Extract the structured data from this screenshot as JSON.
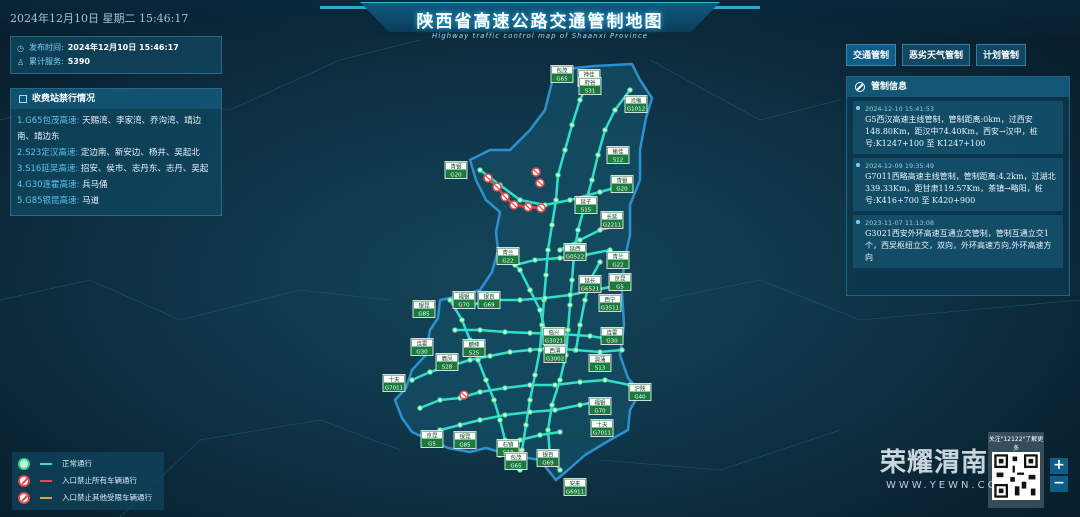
{
  "header": {
    "datetime": "2024年12月10日 星期二  15:46:17",
    "title": "陕西省高速公路交通管制地图",
    "subtitle": "Highway traffic control map of Shaanxi Province"
  },
  "publish": {
    "time_label": "发布时间:",
    "time_value": "2024年12月10日  15:46:17",
    "service_label": "累计服务:",
    "service_value": "5390"
  },
  "toll_panel": {
    "title": "收费站禁行情况",
    "items": [
      {
        "road": "1.G65包茂高速:",
        "stations": "天赐湾、李家湾、乔沟湾、靖边南、靖边东"
      },
      {
        "road": "2.S23定汉高速:",
        "stations": "定边南、新安边、杨井、吴起北"
      },
      {
        "road": "3.S16延吴高速:",
        "stations": "招安、侯市、志丹东、志丹、吴起"
      },
      {
        "road": "4.G30连霍高速:",
        "stations": "兵马俑"
      },
      {
        "road": "5.G85银昆高速:",
        "stations": "马道"
      }
    ]
  },
  "tabs": [
    "交通管制",
    "恶劣天气管制",
    "计划管制"
  ],
  "control_panel": {
    "title": "管制信息",
    "notices": [
      {
        "time": "2024-12-10 15:41:53",
        "text": "G5西汉高速主线管制，管制距离:0km，过西安148.80Km，距汉中74.40Km，西安→汉中，桩号:K1247+100 至 K1247+100"
      },
      {
        "time": "2024-12-09 19:35:49",
        "text": "G7011西略高速主线管制，管制距离:4.2km，过湖北339.33Km，距甘肃119.57Km，茶镇→略阳，桩号:K416+700 至 K420+900"
      },
      {
        "time": "2023-11-07 11:13:08",
        "text": "G3021西安外环高速互通立交管制，管制互通立交1个，西吴枢纽立交，双向，外环高速方向,外环高速方向"
      }
    ]
  },
  "legend": {
    "items": [
      {
        "label": "正常通行",
        "line_color": "#2fe0c8"
      },
      {
        "label": "入口禁止所有车辆通行",
        "line_color": "#e04a4a"
      },
      {
        "label": "入口禁止其他受限车辆通行",
        "line_color": "#f0a030"
      }
    ]
  },
  "highway_labels": [
    {
      "name": "包茂",
      "code": "G65"
    },
    {
      "name": "神佳",
      "code": "S11"
    },
    {
      "name": "府谷",
      "code": "S31"
    },
    {
      "name": "沧榆",
      "code": "G1012"
    },
    {
      "name": "榆佳",
      "code": "S12"
    },
    {
      "name": "青银",
      "code": "G20"
    },
    {
      "name": "青银",
      "code": "G20"
    },
    {
      "name": "延子",
      "code": "S15"
    },
    {
      "name": "长延",
      "code": "G2211"
    },
    {
      "name": "青兰",
      "code": "G22"
    },
    {
      "name": "延西",
      "code": "G0522"
    },
    {
      "name": "青兰",
      "code": "G22"
    },
    {
      "name": "延长",
      "code": "G6521"
    },
    {
      "name": "京昆",
      "code": "G5"
    },
    {
      "name": "福银",
      "code": "G70"
    },
    {
      "name": "银昆",
      "code": "G85"
    },
    {
      "name": "银百",
      "code": "G69"
    },
    {
      "name": "西宁",
      "code": "G3511"
    },
    {
      "name": "临兴",
      "code": "G3021"
    },
    {
      "name": "连霍",
      "code": "G30"
    },
    {
      "name": "麟绛",
      "code": "S25"
    },
    {
      "name": "连霍",
      "code": "G30"
    },
    {
      "name": "西渭",
      "code": "G3002"
    },
    {
      "name": "眉凤",
      "code": "S28"
    },
    {
      "name": "渭蒲",
      "code": "S13"
    },
    {
      "name": "十天",
      "code": "G7011"
    },
    {
      "name": "沪陕",
      "code": "G40"
    },
    {
      "name": "福银",
      "code": "G70"
    },
    {
      "name": "十天",
      "code": "G7011"
    },
    {
      "name": "京昆",
      "code": "G5"
    },
    {
      "name": "银昆",
      "code": "G85"
    },
    {
      "name": "石镇",
      "code": "S27"
    },
    {
      "name": "包茂",
      "code": "G65"
    },
    {
      "name": "银百",
      "code": "G69"
    },
    {
      "name": "安来",
      "code": "G6911"
    }
  ],
  "watermark": {
    "text": "荣耀渭南",
    "url": "WWW.YEWN.COM",
    "qr_caption": "关注\"12122\"了解更多"
  },
  "zoom": {
    "in": "+",
    "out": "−"
  }
}
